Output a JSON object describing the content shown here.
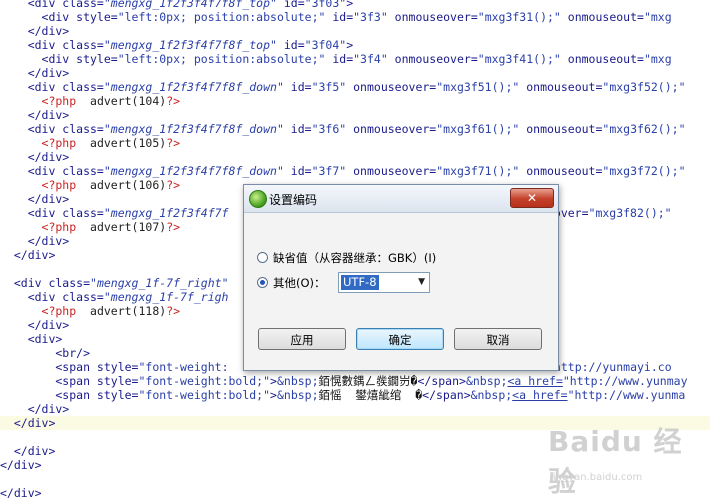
{
  "editor": {
    "lines": [
      [
        {
          "t": "    <div class=",
          "c": "c-tag"
        },
        {
          "t": "\"mengxg_1f2f3f4f7f8f_top\"",
          "c": "c-stri"
        },
        {
          "t": " id=",
          "c": "c-tag"
        },
        {
          "t": "\"3f03\"",
          "c": "c-str"
        },
        {
          "t": ">",
          "c": "c-tag"
        }
      ],
      [
        {
          "t": "      <div style=",
          "c": "c-tag"
        },
        {
          "t": "\"left:0px; position:absolute;\"",
          "c": "c-str"
        },
        {
          "t": " id=",
          "c": "c-tag"
        },
        {
          "t": "\"3f3\"",
          "c": "c-str"
        },
        {
          "t": " onmouseover=",
          "c": "c-tag"
        },
        {
          "t": "\"mxg3f31();\"",
          "c": "c-str"
        },
        {
          "t": " onmouseout=",
          "c": "c-tag"
        },
        {
          "t": "\"mxg",
          "c": "c-str"
        }
      ],
      [
        {
          "t": "    </div>",
          "c": "c-tag"
        }
      ],
      [
        {
          "t": "    <div class=",
          "c": "c-tag"
        },
        {
          "t": "\"mengxg_1f2f3f4f7f8f_top\"",
          "c": "c-stri"
        },
        {
          "t": " id=",
          "c": "c-tag"
        },
        {
          "t": "\"3f04\"",
          "c": "c-str"
        },
        {
          "t": ">",
          "c": "c-tag"
        }
      ],
      [
        {
          "t": "      <div style=",
          "c": "c-tag"
        },
        {
          "t": "\"left:0px; position:absolute;\"",
          "c": "c-str"
        },
        {
          "t": " id=",
          "c": "c-tag"
        },
        {
          "t": "\"3f4\"",
          "c": "c-str"
        },
        {
          "t": " onmouseover=",
          "c": "c-tag"
        },
        {
          "t": "\"mxg3f41();\"",
          "c": "c-str"
        },
        {
          "t": " onmouseout=",
          "c": "c-tag"
        },
        {
          "t": "\"mxg",
          "c": "c-str"
        }
      ],
      [
        {
          "t": "    </div>",
          "c": "c-tag"
        }
      ],
      [
        {
          "t": "    <div class=",
          "c": "c-tag"
        },
        {
          "t": "\"mengxg_1f2f3f4f7f8f_down\"",
          "c": "c-stri"
        },
        {
          "t": " id=",
          "c": "c-tag"
        },
        {
          "t": "\"3f5\"",
          "c": "c-str"
        },
        {
          "t": " onmouseover=",
          "c": "c-tag"
        },
        {
          "t": "\"mxg3f51();\"",
          "c": "c-str"
        },
        {
          "t": " onmouseout=",
          "c": "c-tag"
        },
        {
          "t": "\"mxg3f52();\"",
          "c": "c-str"
        }
      ],
      [
        {
          "t": "      <?php",
          "c": "c-php"
        },
        {
          "t": "  advert(104)",
          "c": "c-fn"
        },
        {
          "t": "?>",
          "c": "c-php"
        }
      ],
      [
        {
          "t": "    </div>",
          "c": "c-tag"
        }
      ],
      [
        {
          "t": "    <div class=",
          "c": "c-tag"
        },
        {
          "t": "\"mengxg_1f2f3f4f7f8f_down\"",
          "c": "c-stri"
        },
        {
          "t": " id=",
          "c": "c-tag"
        },
        {
          "t": "\"3f6\"",
          "c": "c-str"
        },
        {
          "t": " onmouseover=",
          "c": "c-tag"
        },
        {
          "t": "\"mxg3f61();\"",
          "c": "c-str"
        },
        {
          "t": " onmouseout=",
          "c": "c-tag"
        },
        {
          "t": "\"mxg3f62();\"",
          "c": "c-str"
        }
      ],
      [
        {
          "t": "      <?php",
          "c": "c-php"
        },
        {
          "t": "  advert(105)",
          "c": "c-fn"
        },
        {
          "t": "?>",
          "c": "c-php"
        }
      ],
      [
        {
          "t": "    </div>",
          "c": "c-tag"
        }
      ],
      [
        {
          "t": "    <div class=",
          "c": "c-tag"
        },
        {
          "t": "\"mengxg_1f2f3f4f7f8f_down\"",
          "c": "c-stri"
        },
        {
          "t": " id=",
          "c": "c-tag"
        },
        {
          "t": "\"3f7\"",
          "c": "c-str"
        },
        {
          "t": " onmouseover=",
          "c": "c-tag"
        },
        {
          "t": "\"mxg3f71();\"",
          "c": "c-str"
        },
        {
          "t": " onmouseout=",
          "c": "c-tag"
        },
        {
          "t": "\"mxg3f72();\"",
          "c": "c-str"
        }
      ],
      [
        {
          "t": "      <?php",
          "c": "c-php"
        },
        {
          "t": "  advert(106)",
          "c": "c-fn"
        },
        {
          "t": "?>",
          "c": "c-php"
        }
      ],
      [
        {
          "t": "    </div>",
          "c": "c-tag"
        }
      ],
      [
        {
          "t": "    <div class=",
          "c": "c-tag"
        },
        {
          "t": "\"mengxg_1f2f3f4f7f",
          "c": "c-stri"
        },
        {
          "t": "                                         nmouseover=",
          "c": "c-tag"
        },
        {
          "t": "\"mxg3f82();\"",
          "c": "c-str"
        }
      ],
      [
        {
          "t": "      <?php",
          "c": "c-php"
        },
        {
          "t": "  advert(107)",
          "c": "c-fn"
        },
        {
          "t": "?>",
          "c": "c-php"
        }
      ],
      [
        {
          "t": "    </div>",
          "c": "c-tag"
        }
      ],
      [
        {
          "t": "  </div>",
          "c": "c-tag"
        }
      ],
      [],
      [
        {
          "t": "  <div class=",
          "c": "c-tag"
        },
        {
          "t": "\"mengxg_1f-7f_right\"",
          "c": "c-stri"
        }
      ],
      [
        {
          "t": "    <div class=",
          "c": "c-tag"
        },
        {
          "t": "\"mengxg_1f-7f_righ",
          "c": "c-stri"
        }
      ],
      [
        {
          "t": "      <?php",
          "c": "c-php"
        },
        {
          "t": "  advert(118)",
          "c": "c-fn"
        },
        {
          "t": "?>",
          "c": "c-php"
        }
      ],
      [
        {
          "t": "    </div>",
          "c": "c-tag"
        }
      ],
      [
        {
          "t": "    <div>",
          "c": "c-tag"
        }
      ],
      [
        {
          "t": "        <br/>",
          "c": "c-tag"
        }
      ],
      [
        {
          "t": "        <span style=",
          "c": "c-tag"
        },
        {
          "t": "\"font-weight:",
          "c": "c-str"
        },
        {
          "t": "                                         ",
          "c": "c-tag"
        },
        {
          "t": "href=",
          "c": "c-tag"
        },
        {
          "t": "\"http://yunmayi.co",
          "c": "c-str"
        }
      ],
      [
        {
          "t": "        <span style=",
          "c": "c-tag"
        },
        {
          "t": "\"font-weight:bold;\"",
          "c": "c-str"
        },
        {
          "t": ">",
          "c": "c-tag"
        },
        {
          "t": "&nbsp;",
          "c": "c-ent"
        },
        {
          "t": "銆愰數鍝ㄥ彂鐗岃�",
          "c": "c-txt"
        },
        {
          "t": "</span>",
          "c": "c-tag"
        },
        {
          "t": "&nbsp;",
          "c": "c-ent"
        },
        {
          "t": "<a href=",
          "c": "c-link"
        },
        {
          "t": "\"http://www.yunmay",
          "c": "c-str"
        }
      ],
      [
        {
          "t": "        <span style=",
          "c": "c-tag"
        },
        {
          "t": "\"font-weight:bold;\"",
          "c": "c-str"
        },
        {
          "t": ">",
          "c": "c-tag"
        },
        {
          "t": "&nbsp;",
          "c": "c-ent"
        },
        {
          "t": "銆愮  鐢熺紪绾  �",
          "c": "c-txt"
        },
        {
          "t": "</span>",
          "c": "c-tag"
        },
        {
          "t": "&nbsp;",
          "c": "c-ent"
        },
        {
          "t": "<a href=",
          "c": "c-link"
        },
        {
          "t": "\"http://www.yunma",
          "c": "c-str"
        }
      ],
      [
        {
          "t": "    </div>",
          "c": "c-tag"
        }
      ],
      [
        {
          "t": "  </div>",
          "c": "c-tag"
        }
      ],
      [],
      [
        {
          "t": "  </div>",
          "c": "c-tag"
        }
      ],
      [
        {
          "t": "</div>",
          "c": "c-tag"
        }
      ],
      [],
      [
        {
          "t": "</div>",
          "c": "c-tag"
        }
      ]
    ],
    "highlighted_line": 30
  },
  "dialog": {
    "title": "设置编码",
    "close_label": "✕",
    "radio_default_label": "缺省值（从容器继承：GBK）(I)",
    "radio_default_checked": false,
    "radio_other_label": "其他(O)：",
    "radio_other_checked": true,
    "encoding_value": "UTF-8",
    "apply_label": "应用",
    "ok_label": "确定",
    "cancel_label": "取消"
  },
  "watermark": {
    "logo_text": "Baidu 经验",
    "url": "jingyan.baidu.com"
  }
}
